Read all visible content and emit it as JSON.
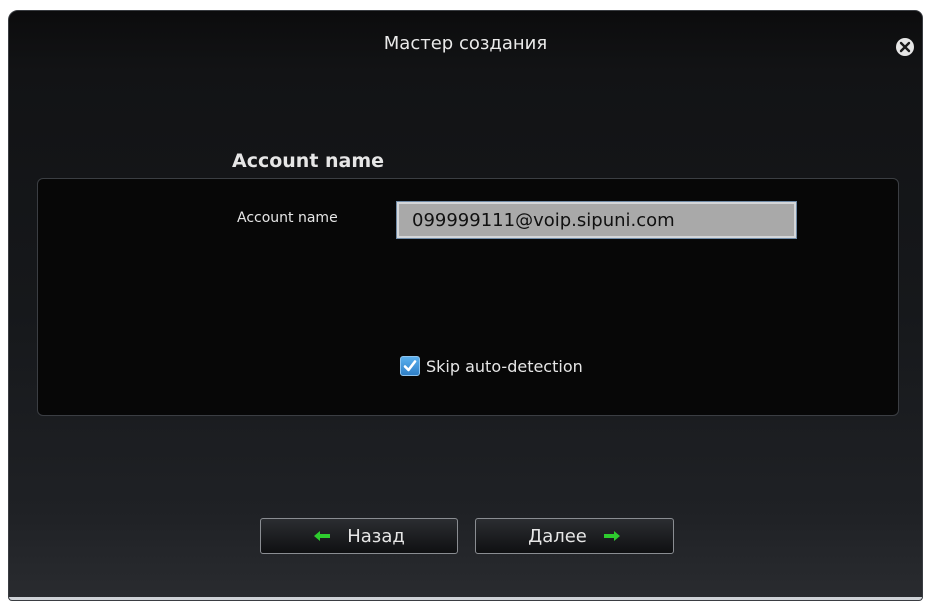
{
  "window": {
    "title": "Мастер создания"
  },
  "section": {
    "heading": "Account name"
  },
  "form": {
    "account_label": "Account name",
    "account_value": "099999111@voip.sipuni.com",
    "skip_label": "Skip auto-detection",
    "skip_checked": true
  },
  "buttons": {
    "back_label": "Назад",
    "next_label": "Далее"
  },
  "icons": {
    "close": "close-icon",
    "back": "arrow-left-icon",
    "next": "arrow-right-icon",
    "check": "checkmark-icon"
  },
  "colors": {
    "accent_green": "#2ecc2e",
    "checkbox_blue": "#3a8fd6"
  }
}
